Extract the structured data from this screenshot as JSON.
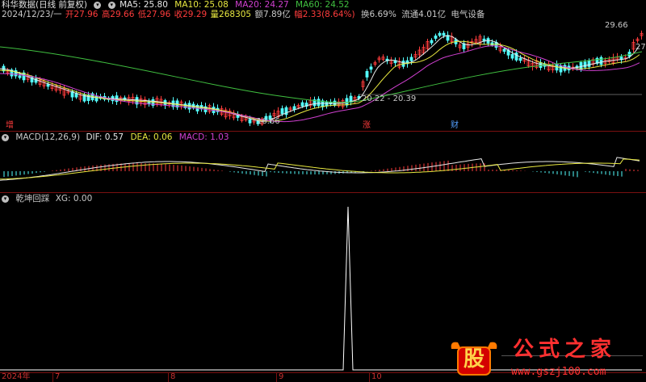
{
  "header": {
    "title": "科华数据(日线 前复权)",
    "ma_labels": [
      {
        "text": "MA5: 25.80",
        "color": "#e8e8e8"
      },
      {
        "text": "MA10: 25.08",
        "color": "#e8e840"
      },
      {
        "text": "MA20: 24.27",
        "color": "#d040d0"
      },
      {
        "text": "MA60: 24.52",
        "color": "#40c040"
      }
    ]
  },
  "quote": {
    "date": "2024/12/23/一",
    "open": "开27.96",
    "high": "高29.66",
    "low": "低27.96",
    "close": "收29.29",
    "volume": "量268305",
    "amount": "额7.89亿",
    "change": "幅2.33(8.64%)",
    "turnover": "换6.69%",
    "float": "流通4.01亿",
    "sector": "电气设备"
  },
  "price_panel": {
    "high_label": "29.66",
    "right_label": "27",
    "low_label": "16.66",
    "range_label": "20.22 - 20.39",
    "markers": [
      "增",
      "涨",
      "财"
    ]
  },
  "macd": {
    "title": "MACD(12,26,9)",
    "dif": "DIF: 0.57",
    "dea": "DEA: 0.06",
    "macd": "MACD: 1.03"
  },
  "indicator": {
    "title": "乾坤回踩",
    "xg": "XG: 0.00"
  },
  "axis": {
    "ticks": [
      "2024年",
      "7",
      "8",
      "9",
      "10"
    ]
  },
  "watermark": {
    "logo_char": "股",
    "brand": "公式之家",
    "url": "www.gszj100.com"
  },
  "colors": {
    "up": "#ff3c3c",
    "down": "#54ffff",
    "ma5": "#e8e8e8",
    "ma10": "#e8e840",
    "ma20": "#d040d0",
    "ma60": "#40c040",
    "grid": "#7a1010"
  }
}
